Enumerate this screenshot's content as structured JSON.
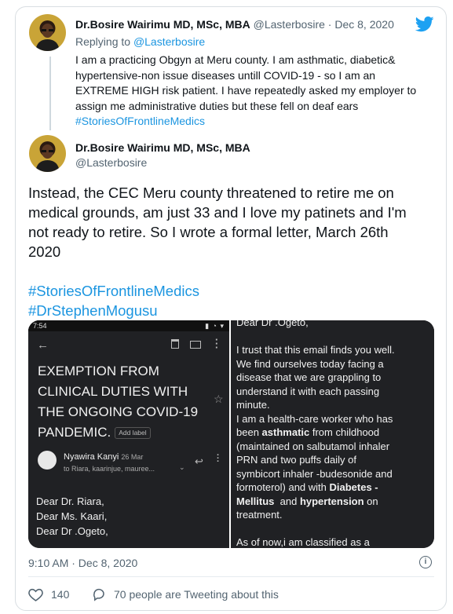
{
  "reply_tweet": {
    "author_name": "Dr.Bosire Wairimu MD, MSc, MBA",
    "author_handle": "@Lasterbosire",
    "separator": "·",
    "date": "Dec 8, 2020",
    "replying_prefix": "Replying to",
    "replying_handle": "@Lasterbosire",
    "lines": [
      "I am a practicing Obgyn at Meru county. I am asthmatic, diabetic&",
      "hypertensive-non issue diseases untill COVID-19 - so I am an",
      "EXTREME HIGH risk patient. I have repeatedly asked my employer to",
      "assign me administrative duties but these fell on deaf ears"
    ],
    "hashtag": "#StoriesOfFrontlineMedics"
  },
  "main_tweet": {
    "author_name": "Dr.Bosire Wairimu MD, MSc, MBA",
    "author_handle": "@Lasterbosire",
    "lines": [
      "Instead, the CEC Meru county threatened to retire me on",
      "medical grounds, am just 33 and I love my patinets and I'm",
      "not ready to retire. So I wrote a formal letter, March 26th",
      "2020"
    ],
    "hashtags": [
      "#StoriesOfFrontlineMedics",
      "#DrStephenMogusu"
    ],
    "timestamp": "9:10 AM · Dec 8, 2020",
    "likes": "140",
    "retweets_text": "70 people are Tweeting about this"
  },
  "media_left": {
    "status_time": "7:54",
    "subject_lines": [
      "EXEMPTION FROM",
      "CLINICAL DUTIES WITH",
      "THE ONGOING COVID-19",
      "PANDEMIC."
    ],
    "add_label": "Add label",
    "sender": "Nyawira Kanyi",
    "sender_date": "26 Mar",
    "recipients": "to Riara, kaarinjue, mauree...",
    "greetings": [
      "Dear Dr. Riara,",
      "Dear Ms. Kaari,",
      "Dear Dr .Ogeto,"
    ]
  },
  "media_right": {
    "top_line": "Dear Dr .Ogeto,",
    "p1": [
      "I trust that this email finds you well.",
      "We find ourselves today facing a",
      "disease that we are grappling to",
      "understand it  with each passing",
      "minute."
    ],
    "p2_a": "I am a health-care worker who has",
    "p2_b_pre": "been ",
    "p2_b_bold": "asthmatic",
    "p2_b_post": " from childhood",
    "p2_c": "(maintained on salbutamol inhaler",
    "p2_d": "PRN and two puffs daily of",
    "p2_e": "symbicort inhaler -budesonide and",
    "p2_f_pre": "formoterol) and with ",
    "p2_f_bold": "Diabetes -",
    "p2_g_bold1": "Mellitus",
    "p2_g_mid": "  and ",
    "p2_g_bold2": "hypertension",
    "p2_g_post": " on",
    "p2_h": "treatment.",
    "p3": "As of now,i am classified as a"
  }
}
